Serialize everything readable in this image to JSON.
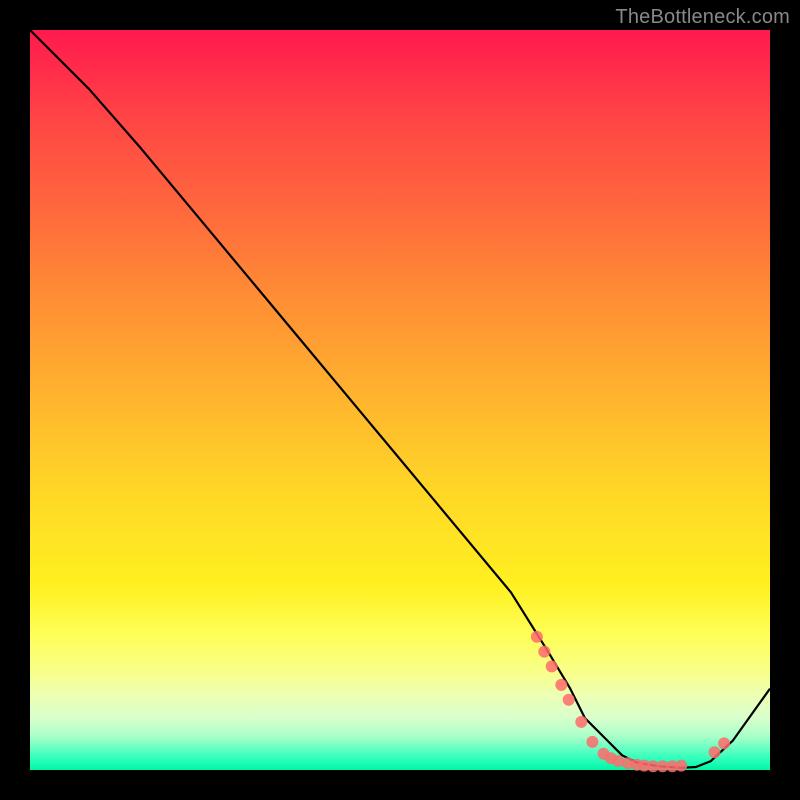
{
  "watermark": "TheBottleneck.com",
  "chart_data": {
    "type": "line",
    "title": "",
    "xlabel": "",
    "ylabel": "",
    "xlim": [
      0,
      100
    ],
    "ylim": [
      0,
      100
    ],
    "series": [
      {
        "name": "curve",
        "x": [
          0,
          8,
          15,
          25,
          35,
          45,
          55,
          65,
          70,
          73,
          75,
          78,
          80,
          82,
          85,
          88,
          90,
          92,
          95,
          100
        ],
        "values": [
          100,
          92,
          84,
          72,
          60,
          48,
          36,
          24,
          16,
          11,
          7,
          4,
          2,
          1,
          0.5,
          0.3,
          0.4,
          1.2,
          4,
          11
        ]
      }
    ],
    "markers": {
      "comment": "scatter dots along the trough of the curve",
      "color": "#ff6b6b",
      "radius": 6,
      "points": [
        {
          "x": 68.5,
          "y": 18
        },
        {
          "x": 69.5,
          "y": 16
        },
        {
          "x": 70.5,
          "y": 14
        },
        {
          "x": 71.8,
          "y": 11.5
        },
        {
          "x": 72.8,
          "y": 9.5
        },
        {
          "x": 74.5,
          "y": 6.5
        },
        {
          "x": 76.0,
          "y": 3.8
        },
        {
          "x": 77.5,
          "y": 2.2
        },
        {
          "x": 78.5,
          "y": 1.6
        },
        {
          "x": 79.5,
          "y": 1.2
        },
        {
          "x": 80.8,
          "y": 0.9
        },
        {
          "x": 82.0,
          "y": 0.7
        },
        {
          "x": 83.0,
          "y": 0.6
        },
        {
          "x": 84.2,
          "y": 0.5
        },
        {
          "x": 85.5,
          "y": 0.5
        },
        {
          "x": 86.8,
          "y": 0.5
        },
        {
          "x": 88.0,
          "y": 0.6
        },
        {
          "x": 92.5,
          "y": 2.4
        },
        {
          "x": 93.8,
          "y": 3.6
        }
      ]
    }
  }
}
